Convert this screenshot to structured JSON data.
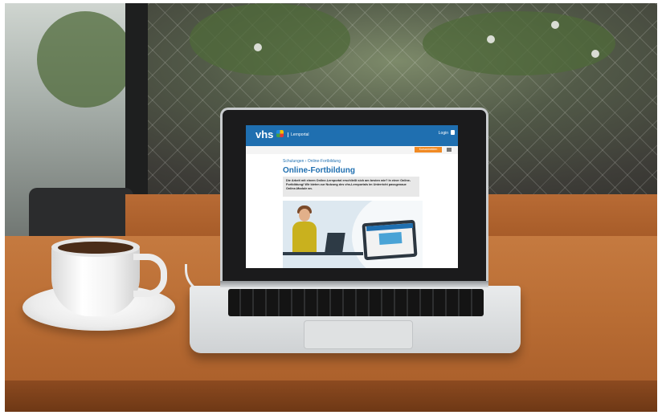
{
  "screen": {
    "logo": "vhs",
    "portal_label": "Lernportal",
    "login_label": "Login",
    "action_button": "Kursanmelden",
    "breadcrumb": "Schulungen › Online-Fortbildung",
    "page_title": "Online-Fortbildung",
    "intro_text": "Die Arbeit mit einem Online-Lernportal erschließt sich am besten wie? In einer Online-Fortbildung! Wir bieten zur Nutzung des vhs-Lernportals im Unterricht passgenaue Online-Module an."
  },
  "colors": {
    "header_blue": "#1f6fb0",
    "accent_orange": "#f08a24",
    "table_wood": "#b96d34"
  },
  "icons": [
    "lock-icon",
    "print-icon",
    "vhs-logo-mark"
  ]
}
